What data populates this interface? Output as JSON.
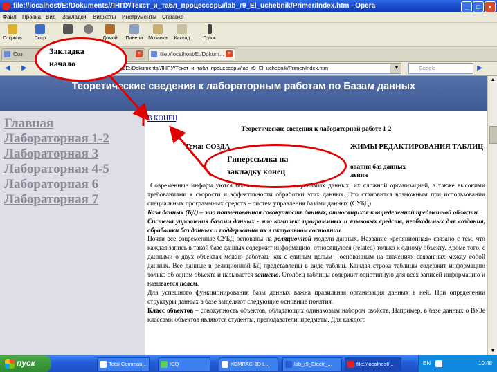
{
  "window": {
    "title": "file://localhost/E:/Dokuments/ЛНПУ/Текст_и_табл_процессоры/lab_r9_El_uchebnik/Primer/Index.htm - Opera",
    "minimize": "_",
    "maximize": "□",
    "close": "×"
  },
  "menu": [
    "Файл",
    "Правка",
    "Вид",
    "Закладки",
    "Виджеты",
    "Инструменты",
    "Справка"
  ],
  "toolbar": [
    {
      "label": "Открыть",
      "color": "#e0b030"
    },
    {
      "label": "Сохр",
      "color": "#3a6fc8"
    },
    {
      "label": "",
      "color": "#555555"
    },
    {
      "label": "",
      "color": "#7a7a7a"
    },
    {
      "label": "Домой",
      "color": "#b06a2a"
    },
    {
      "label": "Панели",
      "color": "#8aa0c0"
    },
    {
      "label": "Мозаика",
      "color": "#c8b070"
    },
    {
      "label": "Каскад",
      "color": "#c8c0a0"
    },
    {
      "label": "Голос",
      "color": "#404040"
    }
  ],
  "tabs": [
    {
      "title": "Соз",
      "close": "×"
    },
    {
      "title": "file://localhost/E:/Dokum...",
      "close": "×"
    }
  ],
  "address": {
    "url": "file://localhost/E:/Dokuments/ЛНПУ/Текст_и_табл_процессоры/lab_r9_El_uchebnik/Primer/Index.htm",
    "search_placeholder": "Google"
  },
  "page": {
    "header": "Теоретические сведения к лабораторным работам по Базам данных",
    "sidebar": [
      "Главная",
      "Лабораторная 1-2",
      "Лабораторная 3",
      "Лабораторная 4-5",
      "Лабораторная 6",
      "Лабораторная 7"
    ],
    "content": {
      "end_link": "В КОНЕЦ",
      "title": "Теоретические сведения к лабораторной работе 1-2",
      "topic_prefix": "Тема: СОЗДА",
      "topic_suffix": "ЖИМЫ РЕДАКТИРОВАНИЯ ТАБЛИЦ",
      "sub1": "ования баз данных",
      "sub2": "ления",
      "p1": "Современные информ                                      уются большими объемами хранимых данных, их сложной организацией, а также высокими  требованиями к скорости и эффективности обработки этих данных.  Это  становится возможным при использовании специальных программных средств – систем управления базами данных (СУБД).",
      "p2": "База данных (БД) – это поименованная совокупность данных, относящихся к определенной предметной области.",
      "p3": "Система управления базами данных - это комплекс программных и языковых средств, необходимых для создания, обработки баз данных и поддержания их в актуальном состоянии.",
      "p4a": "Почти все современные СУБД основаны на ",
      "p4b": "реляционной",
      "p4c": " модели данных. Название «реляционная» связано с тем, что  каждая запись в такой базе данных содержит информацию, относящуюся (related)  только к одному объекту. Кроме того, с данными о двух объектах можно работать как с единым целым , основанным на значениях связанных между собой данных. Все данные в реляционной БД представлены в виде таблиц. Каждая строка таблицы содержит информацию только об одном объекте и называется ",
      "p4d": "записью",
      "p4e": ".  Столбец таблицы содержит  однотипную  для  всех записей информацию и называется ",
      "p4f": "полем",
      "p4g": ".",
      "p5": "Для успешного функционирования базы данных важна правильная организация данных в ней. При определении структуры данных в базе  выделяют следующие основные понятия.",
      "p6a": "Класс объектов",
      "p6b": " – совокупность объектов, обладающих одинаковым набором свойств. Например, в базе данных о ВУЗе  классами объектов являются студенты, преподаватели, предметы. Для каждого"
    }
  },
  "annotations": {
    "bookmark_start": [
      "Закладка",
      "начало"
    ],
    "hyperlink_end": [
      "Гиперссылка на",
      "закладку  конец"
    ],
    "color": "#e00000"
  },
  "taskbar": {
    "start": "пуск",
    "items": [
      "Total Comman...",
      "ICQ",
      "КОМПАС-3D L...",
      "lab_r9_Electr_...",
      "file://localhost/...",
      ""
    ],
    "lang": "EN",
    "clock": "10:48"
  }
}
